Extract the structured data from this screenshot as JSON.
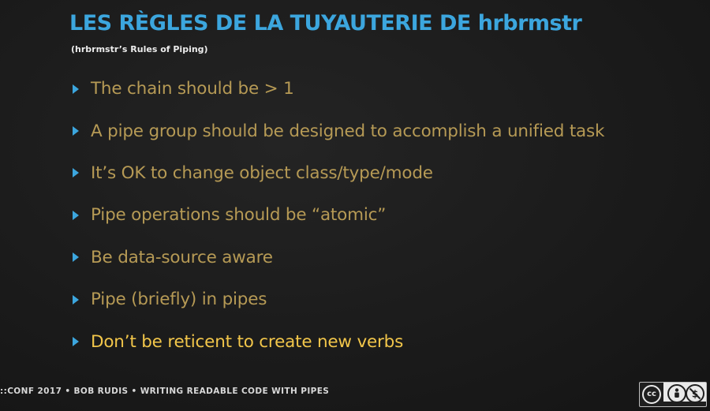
{
  "slide": {
    "title": "LES RÈGLES DE LA TUYAUTERIE DE hrbrmstr",
    "subtitle": "(hrbrmstr’s Rules of Piping)",
    "bullets": [
      "The chain should be > 1",
      "A pipe group should be designed to accomplish a unified task",
      "It’s OK to change object class/type/mode",
      "Pipe operations should be “atomic”",
      "Be data-source aware",
      "Pipe (briefly) in pipes",
      "Don’t be reticent to create new verbs"
    ],
    "highlighted_index": 6,
    "footer": "::CONF 2017 • BOB RUDIS • WRITING READABLE CODE WITH PIPES"
  },
  "license_badge": {
    "cc_label": "cc",
    "icons": [
      "person-icon",
      "no-dollar-icon"
    ]
  },
  "colors": {
    "title": "#3ca6de",
    "bullet_arrow": "#3ca6de",
    "bullet_text": "#b69a55",
    "bullet_highlight": "#f2c64a",
    "background": "#1b1b1b"
  }
}
